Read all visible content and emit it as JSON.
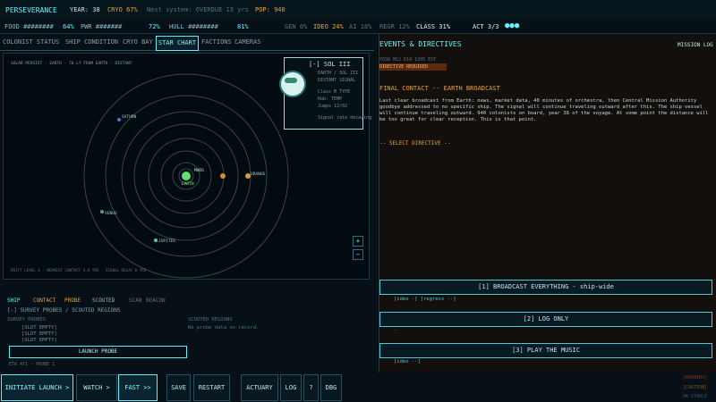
{
  "top": {
    "ship": "PERSEVERANCE",
    "year": "YEAR: 38",
    "cryo": "CRYO 67%",
    "system": "Next system: OVERDUE 13 yrs",
    "pop": "POP: 940"
  },
  "resources": {
    "food": "FOOD ########",
    "food_pct": "64%",
    "pwr": "PWR #######",
    "pwr_pct": "72%",
    "hull": "HULL ########",
    "hull_pct": "81%",
    "gen": "GEN 0%",
    "ideo": "IDEO 24%",
    "ai": "AI 18%",
    "regr": "REGR 12%",
    "class": "CLASS 31%",
    "act": "ACT 3/3"
  },
  "tabs": [
    "COLONIST STATUS",
    "SHIP CONDITION",
    "CRYO BAY",
    "STAR CHART",
    "FACTIONS",
    "CAMERAS"
  ],
  "chart": {
    "header": "SOLAR PERSIST - EARTH - 70 LY FROM EARTH - DISTANT",
    "footer": "DRIFT LEVEL 4 - NEAREST CONTACT 4.8 YRS - SIGNAL DELAY 8 YRS",
    "bodies": [
      {
        "label": "SATURN"
      },
      {
        "label": "MARS"
      },
      {
        "label": "EARTH"
      },
      {
        "label": "VENUS"
      },
      {
        "label": "JUPITER"
      },
      {
        "label": "URANUS"
      }
    ],
    "card": {
      "title": "[-] SOL III",
      "line1": "EARTH / SOL III",
      "line2": "DISTANT SIGNAL",
      "line3": "Class M TYPE",
      "line4": "Hab: TEMP",
      "line5": "Jumps 12/02",
      "line6": "Signal rate decaying"
    }
  },
  "lower": {
    "tabs": [
      "SHIP",
      "CONTACT",
      "PROBE",
      "SCOUTED",
      "SCAN",
      "BEACON"
    ],
    "section": "[-] SURVEY PROBES / SCOUTED REGIONS",
    "survey": "SURVEY PROBES",
    "slots": [
      "[SLOT EMPTY]",
      "[SLOT EMPTY]",
      "[SLOT EMPTY]"
    ],
    "scouted": "SCOUTED REGIONS",
    "noprobe": "No probe data on record.",
    "launch": "LAUNCH PROBE",
    "footer": "ETA 4Y1 - PROBE 1"
  },
  "events": {
    "title": "EVENTS & DIRECTIVES",
    "log": "MISSION LOG",
    "meta": "Y038 M12 D14 1205 EST",
    "tag": "DIRECTIVE REQUIRED",
    "heading": "FINAL CONTACT -- EARTH BROADCAST",
    "body": "Last clear broadcast from Earth: news, market data, 40 minutes of orchestra, then Central Mission Authority goodbye addressed to no specific ship. The signal will continue traveling outward after this. The ship vessel will continue traveling outward. 940 colonists on board, year 38 of the voyage. At some point the distance will be too great for clear reception. This is that point.",
    "select": "-- SELECT DIRECTIVE --",
    "options": [
      {
        "label": "[1]  BROADCAST EVERYTHING - ship-wide",
        "effects": "[ideo -]  [regress --]"
      },
      {
        "label": "[2]  LOG ONLY",
        "effects": "-"
      },
      {
        "label": "[3]  PLAY THE MUSIC",
        "effects": "[ideo --]"
      }
    ]
  },
  "buttons": [
    "INITIATE LAUNCH >",
    "WATCH >",
    "FAST >>",
    "SAVE",
    "RESTART",
    "ACTUARY",
    "LOG",
    "?",
    "DBG"
  ],
  "corner": [
    "[WARNING]",
    "[CAUTION]",
    "OK-STABLE"
  ]
}
